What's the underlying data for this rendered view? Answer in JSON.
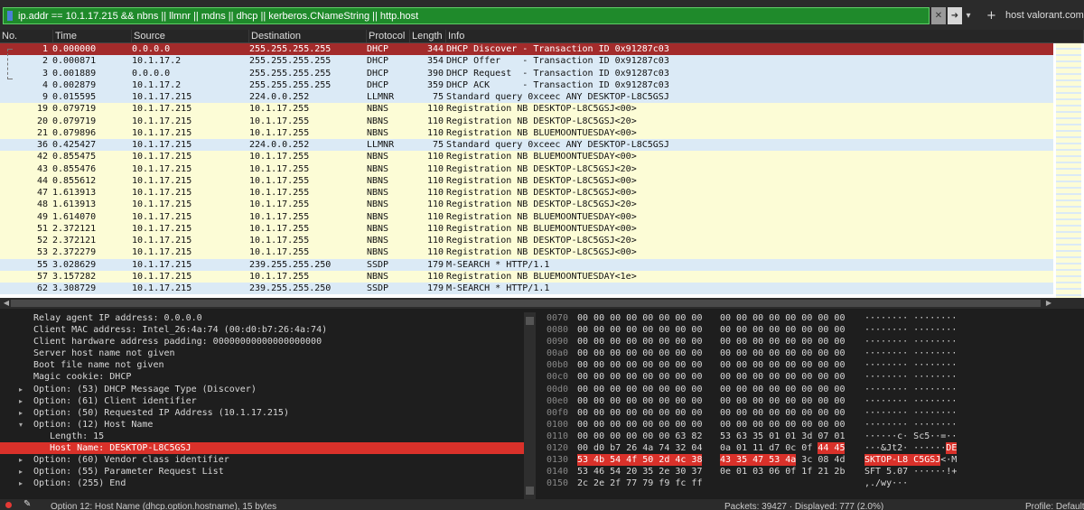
{
  "filter": {
    "text": "ip.addr == 10.1.17.215 && nbns || llmnr || mdns || dhcp || kerberos.CNameString || http.host",
    "clear_icon": "x-icon",
    "apply_icon": "arrow-right-icon",
    "plus_label": "+",
    "host_button": "host valorant.com"
  },
  "columns": [
    "No.",
    "Time",
    "Source",
    "Destination",
    "Protocol",
    "Length",
    "Info"
  ],
  "packets": [
    {
      "no": "1",
      "time": "0.000000",
      "src": "0.0.0.0",
      "dst": "255.255.255.255",
      "proto": "DHCP",
      "len": "344",
      "info": "DHCP Discover - Transaction ID 0x91287c03",
      "cls": "r-sel"
    },
    {
      "no": "2",
      "time": "0.000871",
      "src": "10.1.17.2",
      "dst": "255.255.255.255",
      "proto": "DHCP",
      "len": "354",
      "info": "DHCP Offer    - Transaction ID 0x91287c03",
      "cls": "r-dhcp"
    },
    {
      "no": "3",
      "time": "0.001889",
      "src": "0.0.0.0",
      "dst": "255.255.255.255",
      "proto": "DHCP",
      "len": "390",
      "info": "DHCP Request  - Transaction ID 0x91287c03",
      "cls": "r-dhcp"
    },
    {
      "no": "4",
      "time": "0.002879",
      "src": "10.1.17.2",
      "dst": "255.255.255.255",
      "proto": "DHCP",
      "len": "359",
      "info": "DHCP ACK      - Transaction ID 0x91287c03",
      "cls": "r-dhcp"
    },
    {
      "no": "9",
      "time": "0.015595",
      "src": "10.1.17.215",
      "dst": "224.0.0.252",
      "proto": "LLMNR",
      "len": "75",
      "info": "Standard query 0xceec ANY DESKTOP-L8C5GSJ",
      "cls": "r-llmnr"
    },
    {
      "no": "19",
      "time": "0.079719",
      "src": "10.1.17.215",
      "dst": "10.1.17.255",
      "proto": "NBNS",
      "len": "110",
      "info": "Registration NB DESKTOP-L8C5GSJ<00>",
      "cls": "r-nbns"
    },
    {
      "no": "20",
      "time": "0.079719",
      "src": "10.1.17.215",
      "dst": "10.1.17.255",
      "proto": "NBNS",
      "len": "110",
      "info": "Registration NB DESKTOP-L8C5GSJ<20>",
      "cls": "r-nbns"
    },
    {
      "no": "21",
      "time": "0.079896",
      "src": "10.1.17.215",
      "dst": "10.1.17.255",
      "proto": "NBNS",
      "len": "110",
      "info": "Registration NB BLUEMOONTUESDAY<00>",
      "cls": "r-nbns"
    },
    {
      "no": "36",
      "time": "0.425427",
      "src": "10.1.17.215",
      "dst": "224.0.0.252",
      "proto": "LLMNR",
      "len": "75",
      "info": "Standard query 0xceec ANY DESKTOP-L8C5GSJ",
      "cls": "r-llmnr"
    },
    {
      "no": "42",
      "time": "0.855475",
      "src": "10.1.17.215",
      "dst": "10.1.17.255",
      "proto": "NBNS",
      "len": "110",
      "info": "Registration NB BLUEMOONTUESDAY<00>",
      "cls": "r-nbns"
    },
    {
      "no": "43",
      "time": "0.855476",
      "src": "10.1.17.215",
      "dst": "10.1.17.255",
      "proto": "NBNS",
      "len": "110",
      "info": "Registration NB DESKTOP-L8C5GSJ<20>",
      "cls": "r-nbns"
    },
    {
      "no": "44",
      "time": "0.855612",
      "src": "10.1.17.215",
      "dst": "10.1.17.255",
      "proto": "NBNS",
      "len": "110",
      "info": "Registration NB DESKTOP-L8C5GSJ<00>",
      "cls": "r-nbns"
    },
    {
      "no": "47",
      "time": "1.613913",
      "src": "10.1.17.215",
      "dst": "10.1.17.255",
      "proto": "NBNS",
      "len": "110",
      "info": "Registration NB DESKTOP-L8C5GSJ<00>",
      "cls": "r-nbns"
    },
    {
      "no": "48",
      "time": "1.613913",
      "src": "10.1.17.215",
      "dst": "10.1.17.255",
      "proto": "NBNS",
      "len": "110",
      "info": "Registration NB DESKTOP-L8C5GSJ<20>",
      "cls": "r-nbns"
    },
    {
      "no": "49",
      "time": "1.614070",
      "src": "10.1.17.215",
      "dst": "10.1.17.255",
      "proto": "NBNS",
      "len": "110",
      "info": "Registration NB BLUEMOONTUESDAY<00>",
      "cls": "r-nbns"
    },
    {
      "no": "51",
      "time": "2.372121",
      "src": "10.1.17.215",
      "dst": "10.1.17.255",
      "proto": "NBNS",
      "len": "110",
      "info": "Registration NB BLUEMOONTUESDAY<00>",
      "cls": "r-nbns"
    },
    {
      "no": "52",
      "time": "2.372121",
      "src": "10.1.17.215",
      "dst": "10.1.17.255",
      "proto": "NBNS",
      "len": "110",
      "info": "Registration NB DESKTOP-L8C5GSJ<20>",
      "cls": "r-nbns"
    },
    {
      "no": "53",
      "time": "2.372279",
      "src": "10.1.17.215",
      "dst": "10.1.17.255",
      "proto": "NBNS",
      "len": "110",
      "info": "Registration NB DESKTOP-L8C5GSJ<00>",
      "cls": "r-nbns"
    },
    {
      "no": "55",
      "time": "3.028629",
      "src": "10.1.17.215",
      "dst": "239.255.255.250",
      "proto": "SSDP",
      "len": "179",
      "info": "M-SEARCH * HTTP/1.1",
      "cls": "r-ssdp"
    },
    {
      "no": "57",
      "time": "3.157282",
      "src": "10.1.17.215",
      "dst": "10.1.17.255",
      "proto": "NBNS",
      "len": "110",
      "info": "Registration NB BLUEMOONTUESDAY<1e>",
      "cls": "r-nbns"
    },
    {
      "no": "62",
      "time": "3.308729",
      "src": "10.1.17.215",
      "dst": "239.255.255.250",
      "proto": "SSDP",
      "len": "179",
      "info": "M-SEARCH * HTTP/1.1",
      "cls": "r-ssdp"
    }
  ],
  "details": [
    {
      "text": "Relay agent IP address: 0.0.0.0",
      "arrow": "",
      "indent": 0
    },
    {
      "text": "Client MAC address: Intel_26:4a:74 (00:d0:b7:26:4a:74)",
      "arrow": "",
      "indent": 0
    },
    {
      "text": "Client hardware address padding: 00000000000000000000",
      "arrow": "",
      "indent": 0
    },
    {
      "text": "Server host name not given",
      "arrow": "",
      "indent": 0
    },
    {
      "text": "Boot file name not given",
      "arrow": "",
      "indent": 0
    },
    {
      "text": "Magic cookie: DHCP",
      "arrow": "",
      "indent": 0
    },
    {
      "text": "Option: (53) DHCP Message Type (Discover)",
      "arrow": "▸",
      "indent": 0
    },
    {
      "text": "Option: (61) Client identifier",
      "arrow": "▸",
      "indent": 0
    },
    {
      "text": "Option: (50) Requested IP Address (10.1.17.215)",
      "arrow": "▸",
      "indent": 0
    },
    {
      "text": "Option: (12) Host Name",
      "arrow": "▾",
      "indent": 0
    },
    {
      "text": "Length: 15",
      "arrow": "",
      "indent": 1
    },
    {
      "text": "Host Name: DESKTOP-L8C5GSJ",
      "arrow": "",
      "indent": 1,
      "sel": true
    },
    {
      "text": "Option: (60) Vendor class identifier",
      "arrow": "▸",
      "indent": 0
    },
    {
      "text": "Option: (55) Parameter Request List",
      "arrow": "▸",
      "indent": 0
    },
    {
      "text": "Option: (255) End",
      "arrow": "▸",
      "indent": 0
    }
  ],
  "bytes": [
    {
      "off": "0070",
      "h1": "00 00 00 00 00 00 00 00",
      "h2": "00 00 00 00 00 00 00 00",
      "asc": "········ ········"
    },
    {
      "off": "0080",
      "h1": "00 00 00 00 00 00 00 00",
      "h2": "00 00 00 00 00 00 00 00",
      "asc": "········ ········"
    },
    {
      "off": "0090",
      "h1": "00 00 00 00 00 00 00 00",
      "h2": "00 00 00 00 00 00 00 00",
      "asc": "········ ········"
    },
    {
      "off": "00a0",
      "h1": "00 00 00 00 00 00 00 00",
      "h2": "00 00 00 00 00 00 00 00",
      "asc": "········ ········"
    },
    {
      "off": "00b0",
      "h1": "00 00 00 00 00 00 00 00",
      "h2": "00 00 00 00 00 00 00 00",
      "asc": "········ ········"
    },
    {
      "off": "00c0",
      "h1": "00 00 00 00 00 00 00 00",
      "h2": "00 00 00 00 00 00 00 00",
      "asc": "········ ········"
    },
    {
      "off": "00d0",
      "h1": "00 00 00 00 00 00 00 00",
      "h2": "00 00 00 00 00 00 00 00",
      "asc": "········ ········"
    },
    {
      "off": "00e0",
      "h1": "00 00 00 00 00 00 00 00",
      "h2": "00 00 00 00 00 00 00 00",
      "asc": "········ ········"
    },
    {
      "off": "00f0",
      "h1": "00 00 00 00 00 00 00 00",
      "h2": "00 00 00 00 00 00 00 00",
      "asc": "········ ········"
    },
    {
      "off": "0100",
      "h1": "00 00 00 00 00 00 00 00",
      "h2": "00 00 00 00 00 00 00 00",
      "asc": "········ ········"
    },
    {
      "off": "0110",
      "h1": "00 00 00 00 00 00 63 82",
      "h2": "53 63 35 01 01 3d 07 01",
      "asc": "······c· Sc5··=··"
    },
    {
      "off": "0120",
      "h1": "00 d0 b7 26 4a 74 32 04",
      "h2": "0a 01 11 d7 0c 0f",
      "h2hl": "44 45",
      "asc": "···&Jt2· ······",
      "aschl": "DE"
    },
    {
      "off": "0130",
      "h1hl": "53 4b 54 4f 50 2d 4c 38",
      "h2hl": "43 35 47 53 4a",
      "h2tail": "3c 08 4d",
      "aschl2": "SKTOP-L8 C5GSJ",
      "asctail": "<·M"
    },
    {
      "off": "0140",
      "h1": "53 46 54 20 35 2e 30 37",
      "h2": "0e 01 03 06 0f 1f 21 2b",
      "asc": "SFT 5.07 ······!+"
    },
    {
      "off": "0150",
      "h1": "2c 2e 2f 77 79 f9 fc ff",
      "h2": "",
      "asc": ",./wy···"
    }
  ],
  "status": {
    "message": "Option 12: Host Name (dhcp.option.hostname), 15 bytes",
    "packets": "Packets: 39427 · Displayed: 777 (2.0%)",
    "profile": "Profile: Default"
  }
}
